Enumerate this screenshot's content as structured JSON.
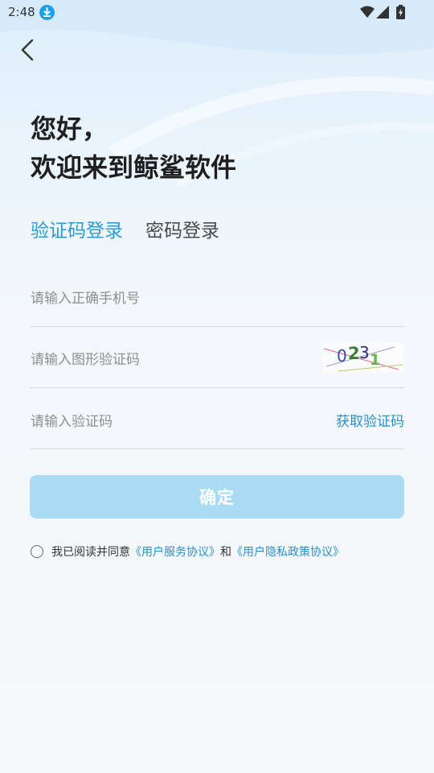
{
  "status_bar": {
    "time": "2:48"
  },
  "greeting": {
    "line1": "您好，",
    "line2": "欢迎来到鲸鲨软件"
  },
  "tabs": [
    {
      "label": "验证码登录",
      "active": true
    },
    {
      "label": "密码登录",
      "active": false
    }
  ],
  "form": {
    "phone_placeholder": "请输入正确手机号",
    "captcha_placeholder": "请输入图形验证码",
    "captcha_code": "0231",
    "sms_placeholder": "请输入验证码",
    "get_code_label": "获取验证码"
  },
  "confirm_button": "确定",
  "agreement": {
    "prefix": "我已阅读并同意",
    "service_link": "《用户服务协议》",
    "conjunction": "和",
    "privacy_link": "《用户隐私政策协议》"
  },
  "colors": {
    "accent": "#2a9cd0",
    "link": "#2b8fc6",
    "button_disabled": "#a9dbf2"
  }
}
